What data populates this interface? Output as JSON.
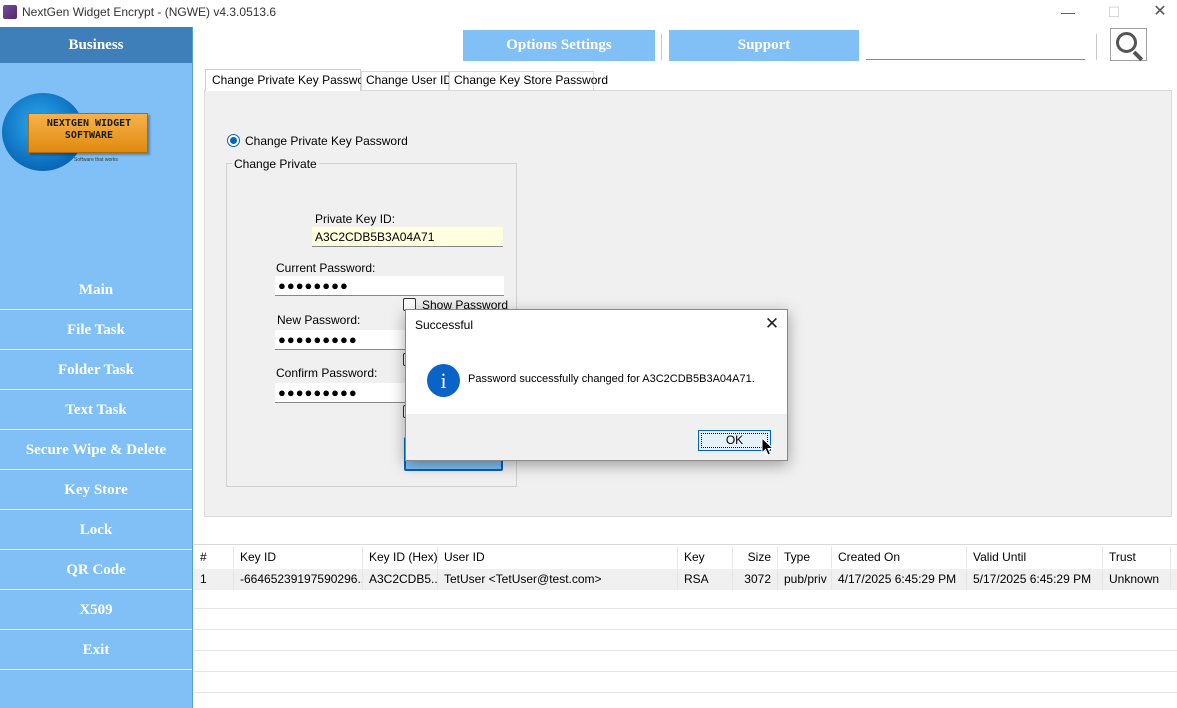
{
  "window": {
    "title": "NextGen Widget Encrypt - (NGWE) v4.3.0513.6"
  },
  "sidebar": {
    "brand": "Business",
    "logo": {
      "title_line1": "NEXTGEN WIDGET",
      "title_line2": "SOFTWARE",
      "tagline": "Software that works"
    },
    "items": [
      "Main",
      "File Task",
      "Folder Task",
      "Text Task",
      "Secure Wipe & Delete",
      "Key Store",
      "Lock",
      "QR Code",
      "X509",
      "Exit"
    ]
  },
  "toolbar": {
    "options_label": "Options Settings",
    "support_label": "Support",
    "search_value": ""
  },
  "tabs": [
    "Change Private Key Password",
    "Change User ID",
    "Change Key Store Password"
  ],
  "form": {
    "radio_label": "Change Private Key Password",
    "group_label": "Change Private",
    "key_id_label": "Private Key ID:",
    "key_id_value": "A3C2CDB5B3A04A71",
    "current_label": "Current Password:",
    "current_value": "●●●●●●●●",
    "show_password_label": "Show Password",
    "new_label": "New Password:",
    "new_value": "●●●●●●●●●",
    "confirm_label": "Confirm Password:",
    "confirm_value": "●●●●●●●●●"
  },
  "grid": {
    "columns": [
      "#",
      "Key ID",
      "Key ID (Hex)",
      "User ID",
      "Key",
      "Size",
      "Type",
      "Created On",
      "Valid Until",
      "Trust"
    ],
    "rows": [
      [
        "1",
        "-66465239197590296...",
        "A3C2CDB5...",
        "TetUser <TetUser@test.com>",
        "RSA",
        "3072",
        "pub/priv",
        "4/17/2025 6:45:29 PM",
        "5/17/2025 6:45:29 PM",
        "Unknown"
      ]
    ]
  },
  "dialog": {
    "title": "Successful",
    "message": "Password successfully changed for A3C2CDB5B3A04A71.",
    "ok_label": "OK",
    "icon_glyph": "i",
    "icon_color": "#0a64c8"
  },
  "colors": {
    "sidebar": "#80c0f6",
    "brand_bar": "#3f7fb9",
    "accent": "#0067c0"
  }
}
